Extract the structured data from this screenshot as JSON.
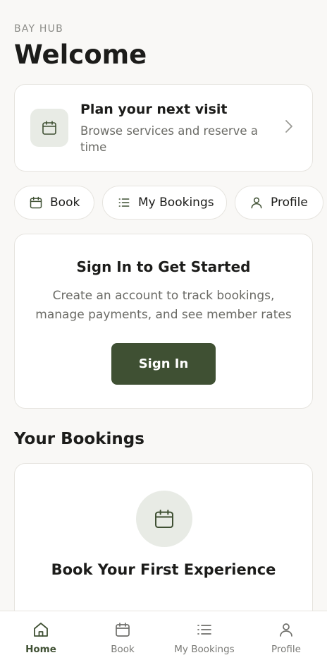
{
  "header": {
    "eyebrow": "BAY HUB",
    "title": "Welcome"
  },
  "plan_card": {
    "title": "Plan your next visit",
    "subtitle": "Browse services and reserve a time",
    "icon": "calendar-icon"
  },
  "quick_actions": [
    {
      "label": "Book",
      "icon": "calendar-icon"
    },
    {
      "label": "My Bookings",
      "icon": "list-icon"
    },
    {
      "label": "Profile",
      "icon": "person-icon"
    }
  ],
  "signin_card": {
    "title": "Sign In to Get Started",
    "description": "Create an account to track bookings, manage payments, and see member rates",
    "button_label": "Sign In"
  },
  "bookings_section": {
    "title": "Your Bookings",
    "empty_title": "Book Your First Experience",
    "empty_icon": "calendar-icon"
  },
  "bottom_nav": {
    "active": "Home",
    "items": [
      {
        "label": "Home",
        "icon": "home-icon"
      },
      {
        "label": "Book",
        "icon": "calendar-icon"
      },
      {
        "label": "My Bookings",
        "icon": "list-icon"
      },
      {
        "label": "Profile",
        "icon": "person-icon"
      }
    ]
  },
  "colors": {
    "accent": "#3f5033",
    "background": "#f9f8f6",
    "icon_bg": "#e8ebe5"
  }
}
